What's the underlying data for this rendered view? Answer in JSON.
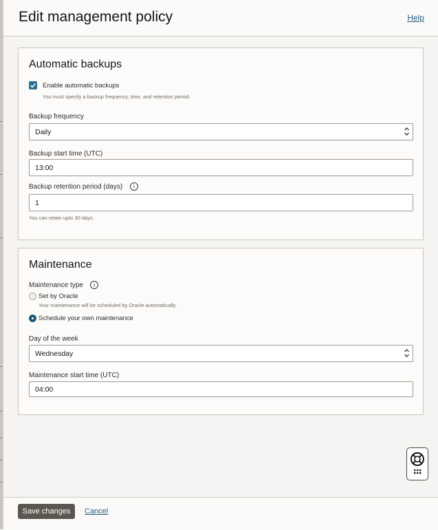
{
  "header": {
    "title": "Edit management policy",
    "help_label": "Help"
  },
  "backups": {
    "section_title": "Automatic backups",
    "enable_label": "Enable automatic backups",
    "enable_checked": true,
    "enable_hint": "You must specify a backup frequency, time, and retention period.",
    "frequency_label": "Backup frequency",
    "frequency_value": "Daily",
    "start_time_label": "Backup start time (UTC)",
    "start_time_value": "13:00",
    "retention_label": "Backup retention period (days)",
    "retention_value": "1",
    "retention_hint": "You can retain upto 30 days."
  },
  "maintenance": {
    "section_title": "Maintenance",
    "type_label": "Maintenance type",
    "options": [
      {
        "label": "Set by Oracle",
        "hint": "Your maintenance will be scheduled by Oracle automatically.",
        "selected": false
      },
      {
        "label": "Schedule your own maintenance",
        "selected": true
      }
    ],
    "day_label": "Day of the week",
    "day_value": "Wednesday",
    "start_time_label": "Maintenance start time (UTC)",
    "start_time_value": "04:00"
  },
  "icons": {
    "info": "info-icon",
    "chevron": "chevron-up-down-icon",
    "help_widget": "lifebuoy-icon",
    "grid": "grid-dots-icon"
  },
  "footer": {
    "save_label": "Save changes",
    "cancel_label": "Cancel"
  },
  "colors": {
    "accent": "#2a6f8e",
    "link": "#1f5c7f",
    "primary_button": "#5c5650"
  }
}
